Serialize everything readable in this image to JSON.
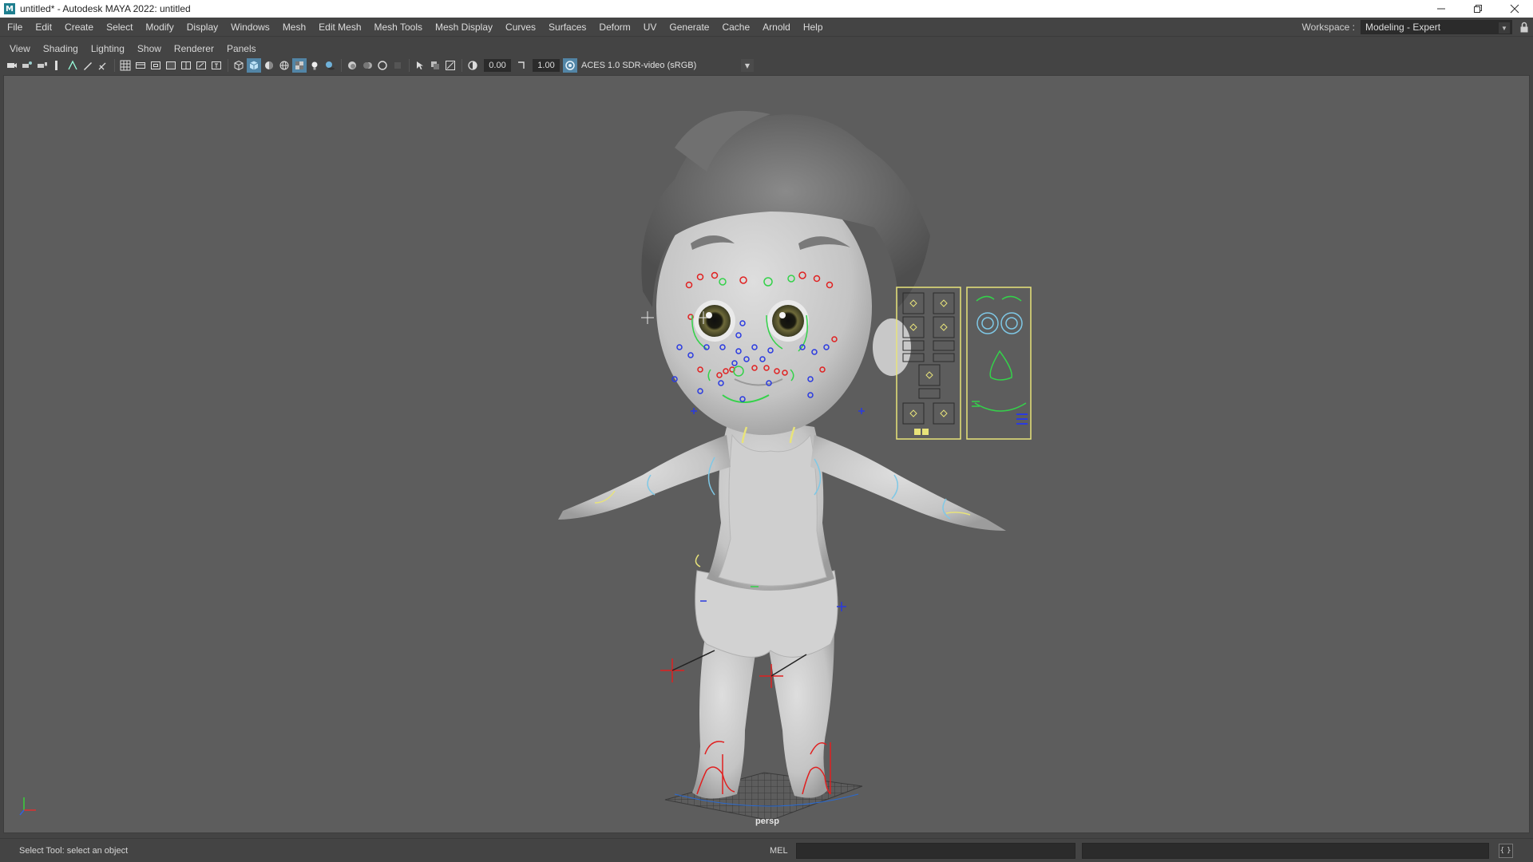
{
  "window": {
    "title": "untitled* - Autodesk MAYA 2022: untitled",
    "app_icon": "M",
    "controls": [
      "minimize-icon",
      "restore-icon",
      "close-icon"
    ]
  },
  "menubar": {
    "items": [
      "File",
      "Edit",
      "Create",
      "Select",
      "Modify",
      "Display",
      "Windows",
      "Mesh",
      "Edit Mesh",
      "Mesh Tools",
      "Mesh Display",
      "Curves",
      "Surfaces",
      "Deform",
      "UV",
      "Generate",
      "Cache",
      "Arnold",
      "Help"
    ]
  },
  "workspace": {
    "label": "Workspace :",
    "value": "Modeling - Expert"
  },
  "panel_menu": {
    "items": [
      "View",
      "Shading",
      "Lighting",
      "Show",
      "Renderer",
      "Panels"
    ]
  },
  "panel_toolbar": {
    "exposure": "0.00",
    "gamma": "1.00",
    "color_space": "ACES 1.0 SDR-video (sRGB)"
  },
  "viewport": {
    "camera": "persp",
    "colors": {
      "background": "#5d5d5d",
      "controller_yellow": "#e8e37a",
      "controller_red": "#e02020",
      "controller_green": "#34d24a",
      "controller_blue": "#2a3ae0",
      "controller_cyan": "#7fc8e6"
    }
  },
  "statusbar": {
    "message": "Select Tool: select an object",
    "command_language": "MEL",
    "command_value": ""
  }
}
